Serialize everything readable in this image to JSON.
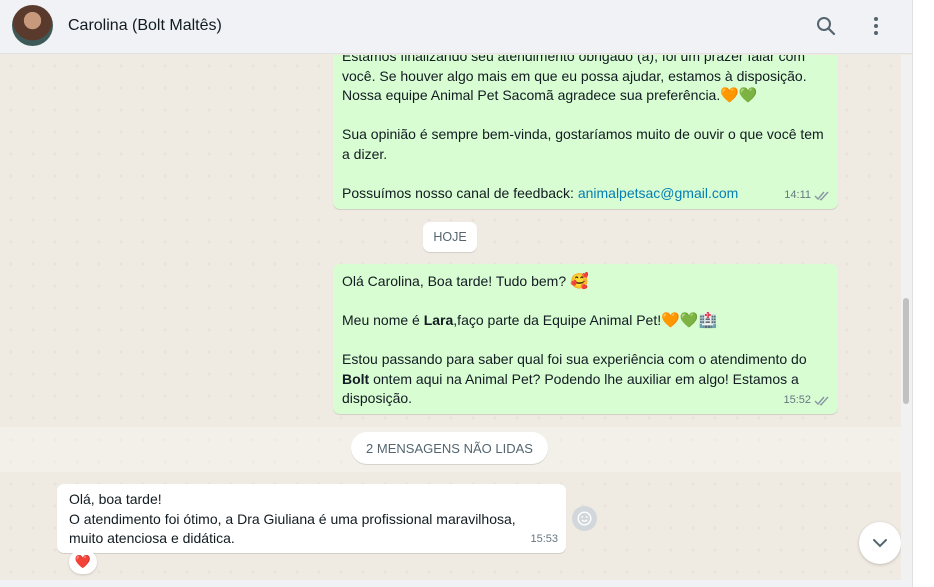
{
  "header": {
    "contact_name": "Carolina (Bolt Maltês)",
    "search_icon": "search-icon",
    "menu_icon": "more-vertical-icon"
  },
  "messages": {
    "m1": {
      "line1": "Estamos finalizando seu atendimento obrigado (a), foi um prazer falar com",
      "line2": "você. Se houver algo mais em que eu possa ajudar, estamos à disposição.",
      "line3": "Nossa equipe Animal Pet Sacomã agradece sua preferência.",
      "line3_emoji": "🧡💚",
      "line4": "Sua opinião é sempre bem-vinda, gostaríamos muito de ouvir o que você tem",
      "line5": "a dizer.",
      "line6_prefix": "Possuímos nosso canal de feedback: ",
      "line6_link": "animalpetsac@gmail.com",
      "time": "14:11"
    },
    "date_divider": "HOJE",
    "m2": {
      "line1": "Olá Carolina, Boa tarde! Tudo bem? ",
      "line1_emoji": "🥰",
      "line2_a": "Meu nome é ",
      "line2_bold": "Lara",
      "line2_b": ",faço parte da Equipe Animal Pet!",
      "line2_emoji": "🧡💚🏥",
      "line3": "Estou passando para saber qual foi sua experiência com o atendimento do",
      "line4_bold": "Bolt",
      "line4_rest": " ontem aqui na Animal Pet? Podendo lhe auxiliar em algo! Estamos a",
      "line5": "disposição.",
      "time": "15:52"
    },
    "unread_label": "2 MENSAGENS NÃO LIDAS",
    "m3": {
      "line1": "Olá, boa tarde!",
      "line2": "O atendimento foi ótimo, a Dra Giuliana é uma profissional maravilhosa,",
      "line3": "muito atenciosa e didática.",
      "time": "15:53",
      "reaction": "❤️"
    }
  },
  "colors": {
    "outgoing_bubble": "#d9fdd3",
    "incoming_bubble": "#ffffff",
    "link": "#027eb5",
    "chat_background": "#efeae2",
    "read_ticks": "#8696a0"
  }
}
